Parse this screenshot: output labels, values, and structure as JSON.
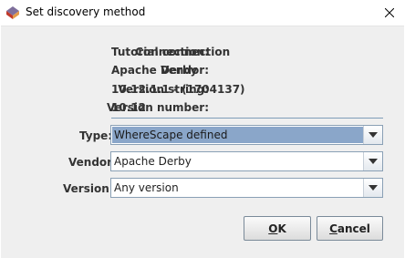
{
  "window": {
    "title": "Set discovery method"
  },
  "info": [
    {
      "label": "Connection:",
      "value": "Tutorial connection"
    },
    {
      "label": "Vendor:",
      "value": "Apache Derby"
    },
    {
      "label": "Version string:",
      "value": "10.12.1.1 - (1704137)"
    },
    {
      "label": "Version number:",
      "value": "10.12"
    }
  ],
  "form": {
    "type": {
      "label": "Type:",
      "value": "WhereScape defined"
    },
    "vendor": {
      "label": "Vendor:",
      "value": "Apache Derby"
    },
    "version": {
      "label": "Version:",
      "value": "Any version"
    }
  },
  "buttons": {
    "ok": {
      "mnemonic": "O",
      "rest": "K"
    },
    "cancel": {
      "mnemonic": "C",
      "rest": "ancel"
    }
  }
}
